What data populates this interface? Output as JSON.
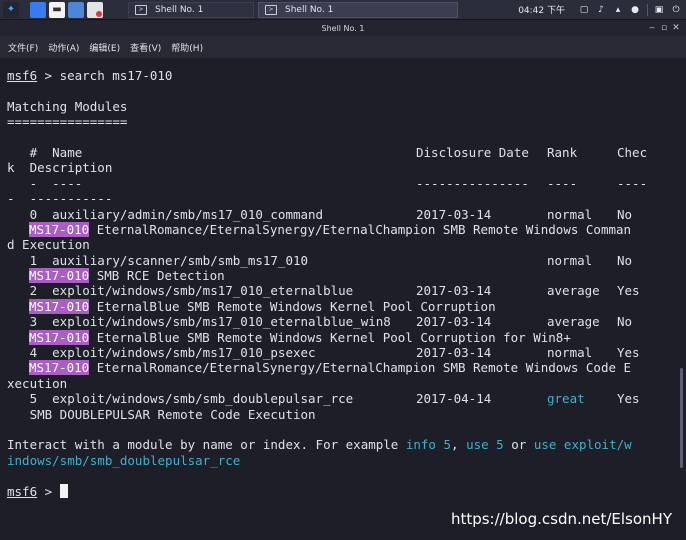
{
  "taskbar": {
    "tasks": [
      {
        "label": "Shell No. 1"
      },
      {
        "label": "Shell No. 1"
      }
    ],
    "clock": "04:42 下午",
    "launcher_icons": [
      "kali-dragon-icon",
      "desktop-icon",
      "file-manager-icon",
      "folder-icon",
      "browser-icon",
      "terminal-icon"
    ],
    "tray_icons": [
      "window-icon",
      "speaker-icon",
      "notification-icon",
      "power-icon",
      "lock-icon",
      "power-button-icon"
    ]
  },
  "window": {
    "title": "Shell No. 1",
    "controls": [
      "minimize-icon",
      "maximize-icon",
      "close-icon"
    ]
  },
  "menu": {
    "items": [
      "文件(F)",
      "动作(A)",
      "编辑(E)",
      "查看(V)",
      "帮助(H)"
    ]
  },
  "terminal": {
    "prompt": "msf6",
    "command_line_1": " > search ms17-010",
    "heading": "Matching Modules",
    "heading_underline": "================",
    "table": {
      "columns": [
        "#",
        "Name",
        "Disclosure Date",
        "Rank",
        "Check",
        "Description"
      ],
      "header_line_1": "   #  Name",
      "header_disclosure": "Disclosure Date",
      "header_rank": "Rank",
      "header_check": "Chec",
      "header_line_2": "k  Description",
      "dash_num": "   -  ----",
      "dash_disclosure": "---------------",
      "dash_rank": "----",
      "dash_check": "----",
      "dash_desc": "-  -----------",
      "rows": [
        {
          "num": "   0  auxiliary/admin/smb/ms17_010_command",
          "date": "2017-03-14",
          "rank": "normal",
          "check": "No",
          "tag": "MS17-010",
          "desc1": " EternalRomance/EternalSynergy/EternalChampion SMB Remote Windows Comman",
          "desc2": "d Execution"
        },
        {
          "num": "   1  auxiliary/scanner/smb/smb_ms17_010",
          "date": "",
          "rank": "normal",
          "check": "No",
          "tag": "MS17-010",
          "desc1": " SMB RCE Detection",
          "desc2": ""
        },
        {
          "num": "   2  exploit/windows/smb/ms17_010_eternalblue",
          "date": "2017-03-14",
          "rank": "average",
          "check": "Yes",
          "tag": "MS17-010",
          "desc1": " EternalBlue SMB Remote Windows Kernel Pool Corruption",
          "desc2": ""
        },
        {
          "num": "   3  exploit/windows/smb/ms17_010_eternalblue_win8",
          "date": "2017-03-14",
          "rank": "average",
          "check": "No",
          "tag": "MS17-010",
          "desc1": " EternalBlue SMB Remote Windows Kernel Pool Corruption for Win8+",
          "desc2": ""
        },
        {
          "num": "   4  exploit/windows/smb/ms17_010_psexec",
          "date": "2017-03-14",
          "rank": "normal",
          "check": "Yes",
          "tag": "MS17-010",
          "desc1": " EternalRomance/EternalSynergy/EternalChampion SMB Remote Windows Code E",
          "desc2": "xecution"
        },
        {
          "num": "   5  exploit/windows/smb/smb_doublepulsar_rce",
          "date": "2017-04-14",
          "rank": "great",
          "check": "Yes",
          "tag": "",
          "desc1": "   SMB DOUBLEPULSAR Remote Code Execution",
          "desc2": ""
        }
      ]
    },
    "interact_prefix": "Interact with a module by name or index. For example ",
    "interact_ex1": "info 5",
    "interact_sep1": ", ",
    "interact_ex2": "use 5",
    "interact_or": " or ",
    "interact_ex3a": "use exploit/w",
    "interact_ex3b": "indows/smb/smb_doublepulsar_rce",
    "prompt_tail": " > "
  },
  "watermark": "https://blog.csdn.net/ElsonHY",
  "colors": {
    "highlight": "#a95fc1",
    "cyan": "#3fb1c8",
    "background": "#1d1e27"
  }
}
